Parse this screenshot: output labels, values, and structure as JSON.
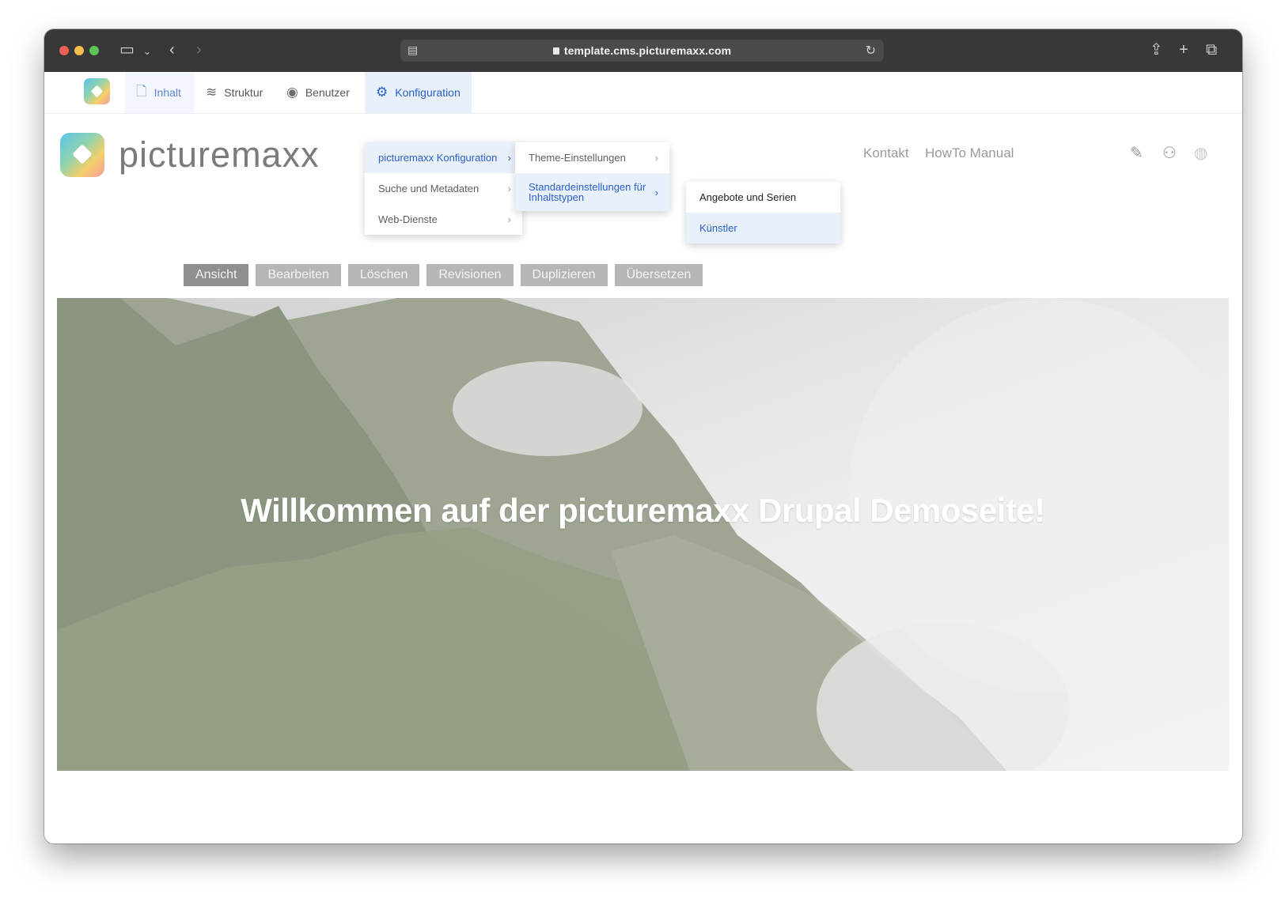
{
  "browser": {
    "url": "template.cms.picturemaxx.com"
  },
  "admin_toolbar": {
    "items": [
      {
        "label": "Inhalt",
        "icon": "document-icon"
      },
      {
        "label": "Struktur",
        "icon": "layers-icon"
      },
      {
        "label": "Benutzer",
        "icon": "user-circle-icon"
      },
      {
        "label": "Konfiguration",
        "icon": "gear-icon"
      }
    ]
  },
  "menus": {
    "level1": [
      {
        "label": "picturemaxx Konfiguration",
        "active": true
      },
      {
        "label": "Suche und Metadaten",
        "active": false
      },
      {
        "label": "Web-Dienste",
        "active": false
      }
    ],
    "level2": [
      {
        "label": "Theme-Einstellungen",
        "active": false
      },
      {
        "label": "Standardeinstellungen für Inhaltstypen",
        "active": true
      }
    ],
    "level3": [
      {
        "label": "Angebote und Serien",
        "active": false
      },
      {
        "label": "Künstler",
        "active": true
      }
    ]
  },
  "site": {
    "brand": "picturemaxx",
    "nav": [
      "Kontakt",
      "HowTo Manual"
    ],
    "icons": [
      "document-edit-icon",
      "user-icon",
      "globe-icon"
    ]
  },
  "tabs": [
    {
      "label": "Ansicht",
      "active": true
    },
    {
      "label": "Bearbeiten",
      "active": false
    },
    {
      "label": "Löschen",
      "active": false
    },
    {
      "label": "Revisionen",
      "active": false
    },
    {
      "label": "Duplizieren",
      "active": false
    },
    {
      "label": "Übersetzen",
      "active": false
    }
  ],
  "hero": {
    "title": "Willkommen auf der picturemaxx Drupal Demoseite!"
  }
}
